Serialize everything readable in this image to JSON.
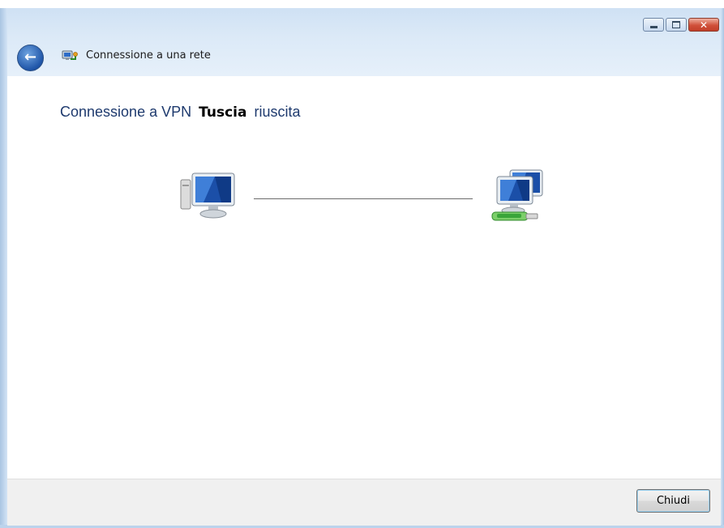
{
  "window": {
    "title": "Connessione a una rete",
    "controls": {
      "minimize_icon": "minimize-icon",
      "maximize_icon": "maximize-icon",
      "close_icon": "close-icon"
    }
  },
  "content": {
    "heading_prefix": "Connessione a VPN",
    "connection_name": "Tuscia",
    "heading_suffix": "riuscita",
    "left_icon": "computer-icon",
    "right_icon": "network-icon"
  },
  "footer": {
    "close_label": "Chiudi"
  },
  "colors": {
    "heading_text": "#1e3a6e",
    "titlebar": "#dbe9f7",
    "close_button_red": "#c23e28"
  }
}
